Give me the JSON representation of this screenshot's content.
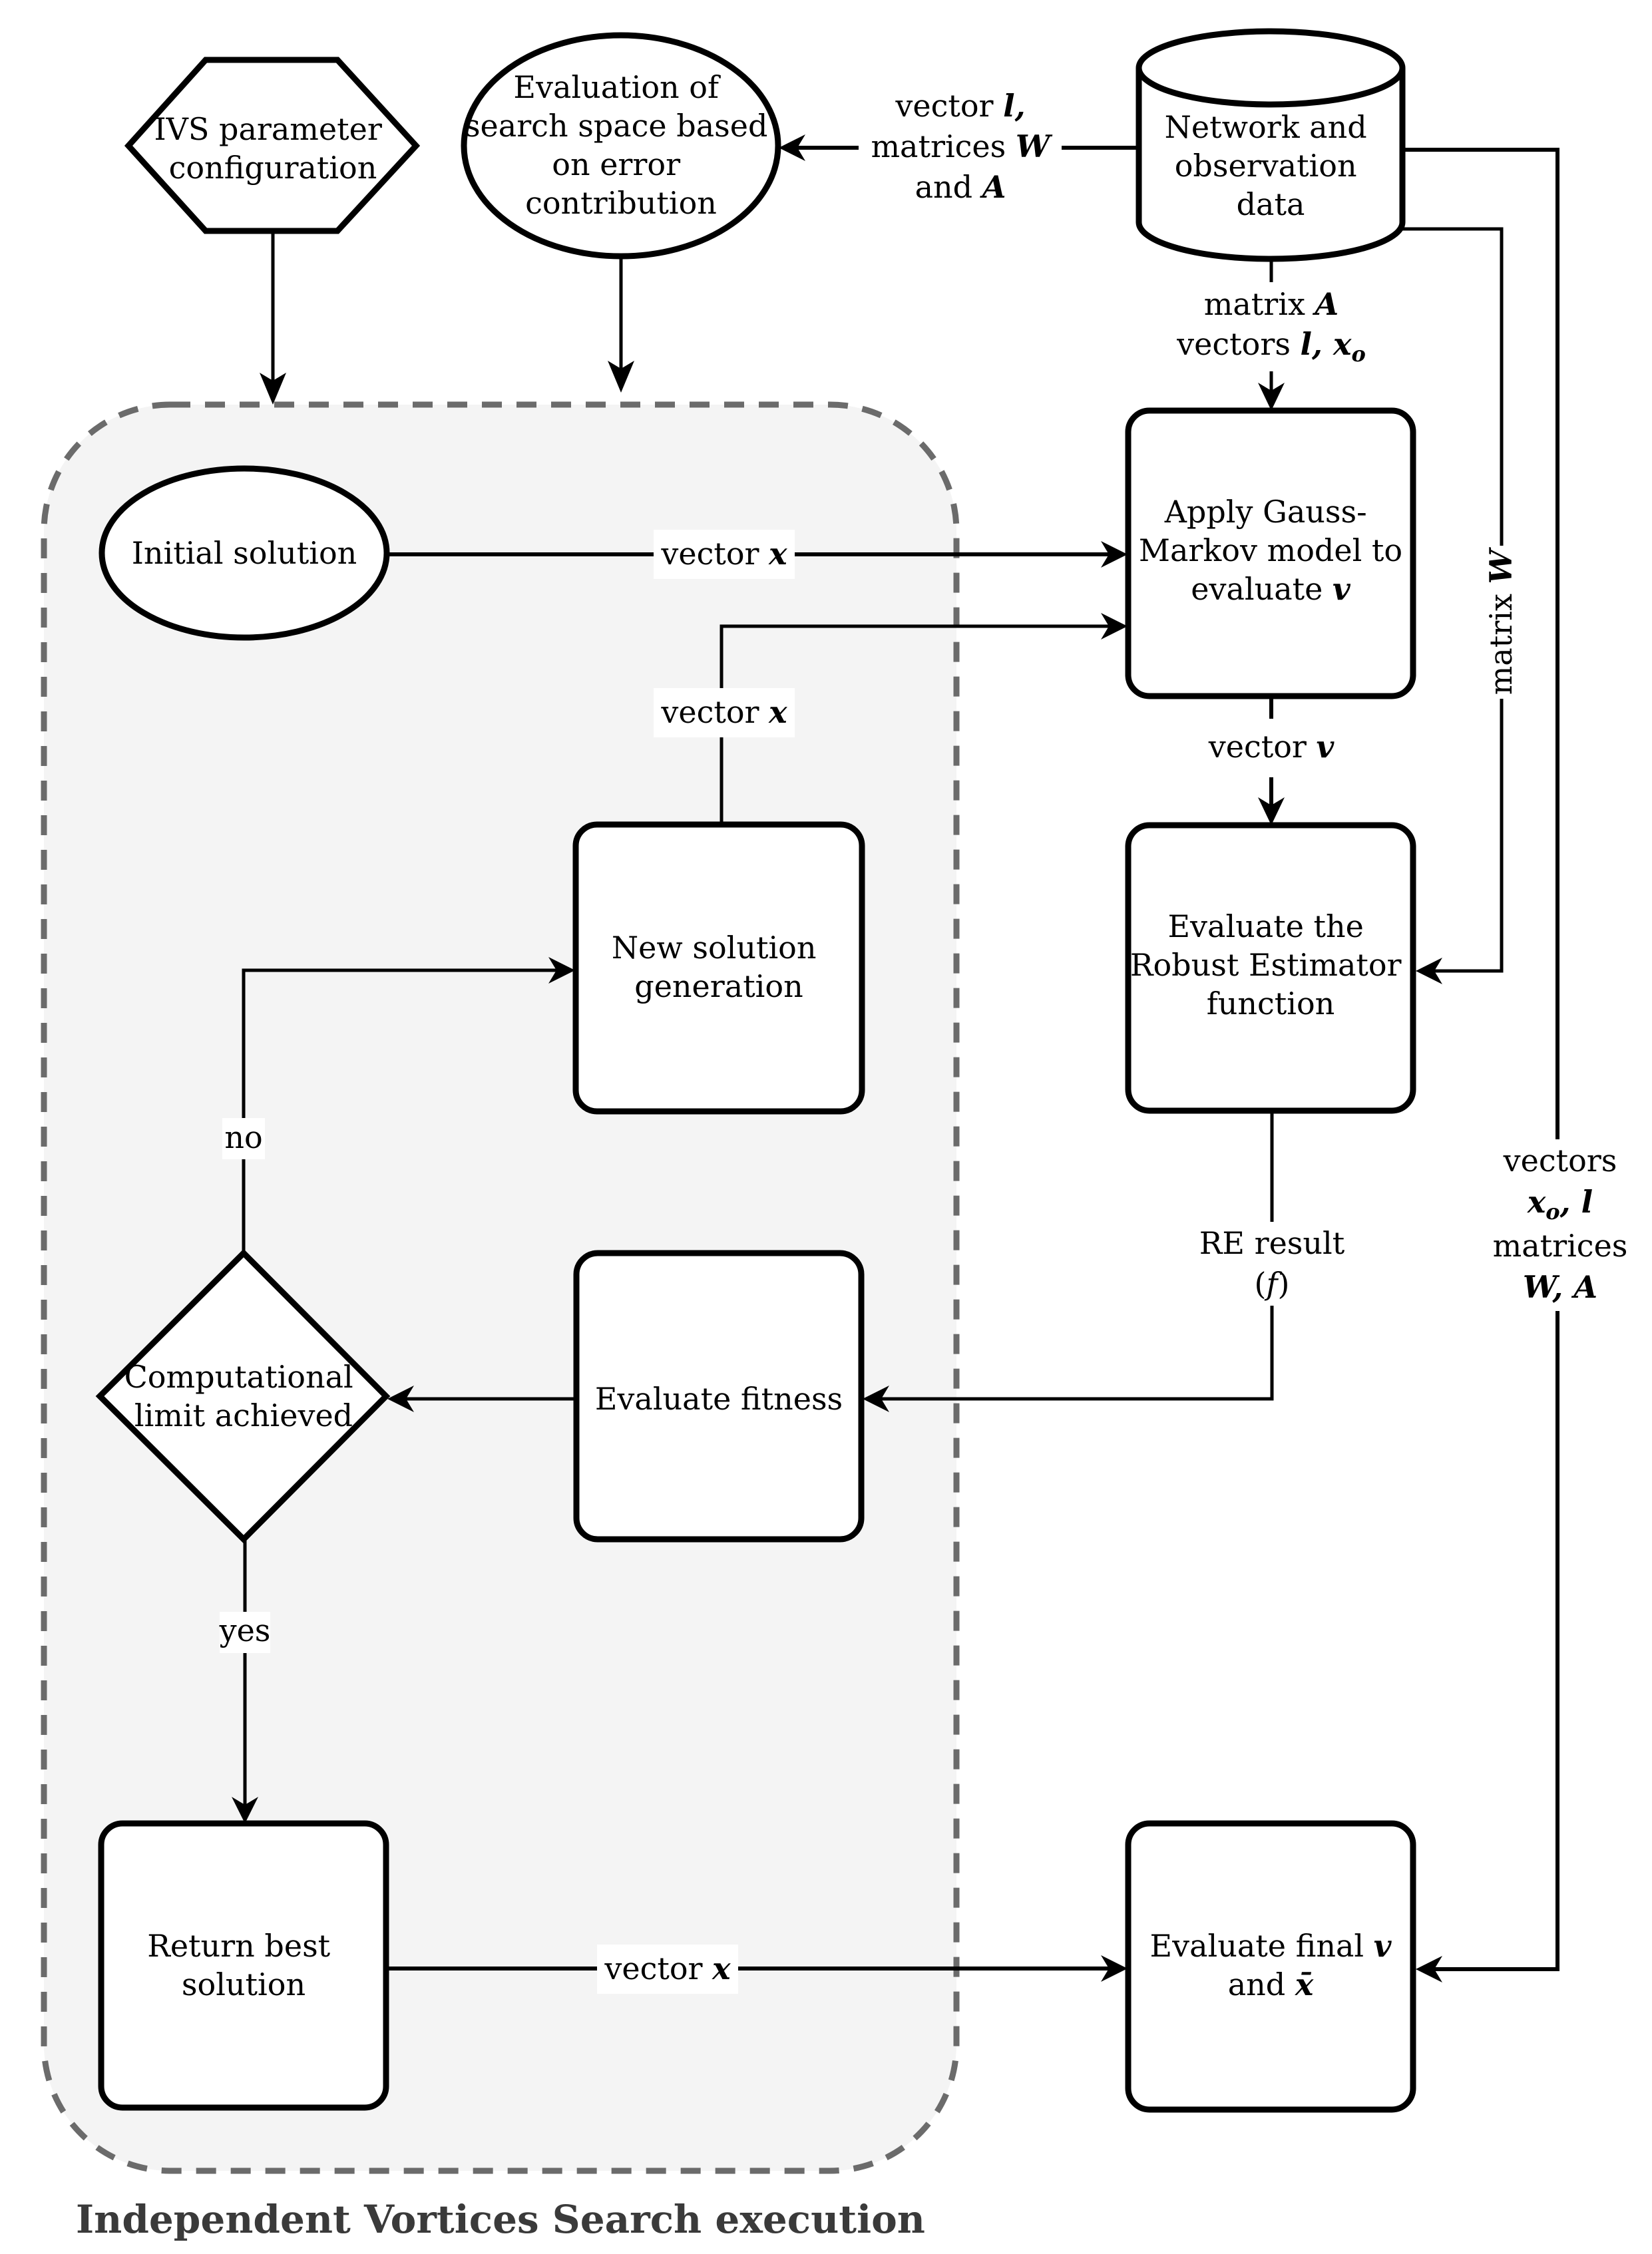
{
  "diagram": {
    "title": "Independent Vortices Search execution",
    "colors": {
      "container_fill": "#f4f4f4",
      "container_border": "#6b6b6b",
      "stroke": "#000000",
      "title_text": "#3a3a3a"
    },
    "nodes": {
      "ivs_config": {
        "shape": "hexagon",
        "lines": [
          "IVS parameter",
          "configuration"
        ]
      },
      "search_space_eval": {
        "shape": "ellipse",
        "lines": [
          "Evaluation of",
          "search space based",
          "on error",
          "contribution"
        ]
      },
      "network_data": {
        "shape": "cylinder",
        "lines": [
          "Network and",
          "observation",
          "data"
        ]
      },
      "initial_solution": {
        "shape": "ellipse",
        "lines": [
          "Initial solution"
        ]
      },
      "gauss_markov": {
        "shape": "rounded-rect",
        "lines": [
          "Apply Gauss-",
          "Markov model to",
          "evaluate"
        ],
        "math": "v"
      },
      "robust_estimator": {
        "shape": "rounded-rect",
        "lines": [
          "Evaluate the",
          "Robust Estimator",
          "function"
        ]
      },
      "new_solution": {
        "shape": "rounded-rect",
        "lines": [
          "New solution",
          "generation"
        ]
      },
      "evaluate_fitness": {
        "shape": "rounded-rect",
        "lines": [
          "Evaluate fitness"
        ]
      },
      "computational_limit": {
        "shape": "diamond",
        "lines": [
          "Computational",
          "limit achieved"
        ]
      },
      "return_best": {
        "shape": "rounded-rect",
        "lines": [
          "Return best",
          "solution"
        ]
      },
      "evaluate_final": {
        "shape": "rounded-rect",
        "lines": [
          "Evaluate final",
          "and"
        ],
        "math": [
          "v",
          "x̄"
        ]
      }
    },
    "edges": {
      "network_to_search": {
        "lines": [
          "vector",
          "matrices",
          "and"
        ],
        "math": [
          "l,",
          "W",
          "A"
        ]
      },
      "network_to_gm": {
        "lines": [
          "matrix",
          "vectors"
        ],
        "math": [
          "A",
          "l, x",
          "o"
        ]
      },
      "initial_to_gm": {
        "text": "vector",
        "math": "x"
      },
      "new_to_gm": {
        "text": "vector",
        "math": "x"
      },
      "gm_to_re": {
        "text": "vector",
        "math": "v"
      },
      "network_to_re": {
        "text": "matrix",
        "math": "W"
      },
      "re_to_fitness": {
        "lines": [
          "RE result",
          "(f)"
        ],
        "math": "f"
      },
      "limit_no": {
        "text": "no"
      },
      "limit_yes": {
        "text": "yes"
      },
      "return_to_final": {
        "text": "vector",
        "math": "x"
      },
      "network_to_final": {
        "lines": [
          "vectors",
          "matrices"
        ],
        "math": [
          "x",
          "o",
          ", l",
          "W, A"
        ]
      }
    }
  }
}
